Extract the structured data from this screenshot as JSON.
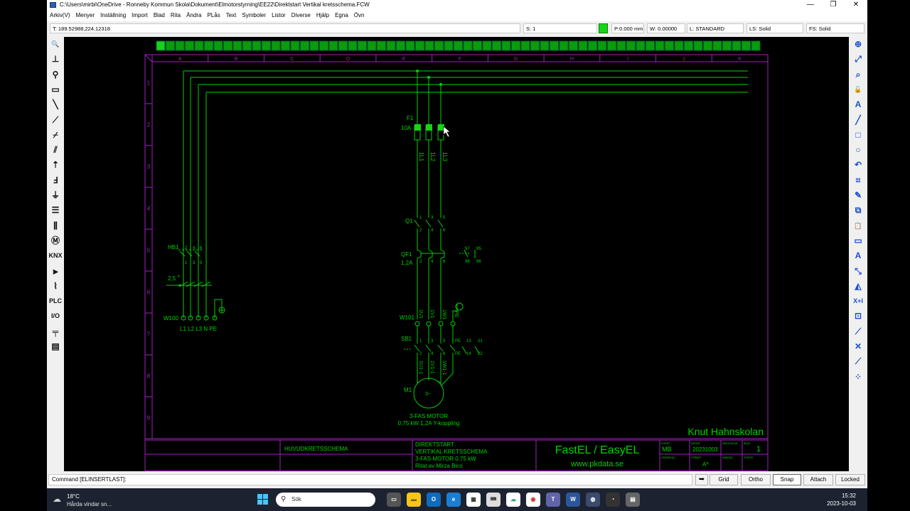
{
  "window": {
    "title": "C:\\Users\\mirbi\\OneDrive - Ronneby Kommun Skola\\Dokument\\Elmotorstyrning\\EE22\\Direktstart Vertikal kretsschema.FCW",
    "minimize": "—",
    "maximize": "❐",
    "close": "✕"
  },
  "menu": [
    "Arkiv(V)",
    "Menyer",
    "Inställning",
    "Import",
    "Blad",
    "Rita",
    "Ändra",
    "PLås",
    "Text",
    "Symboler",
    "Listor",
    "Diverse",
    "Hjälp",
    "Egna",
    "Övn"
  ],
  "status": {
    "coords": "T: 189.52988,224.12318",
    "scale": "S: 1",
    "pen": "P:0.000 mm",
    "width": "W: 0.00000",
    "layer": "L: STANDARD",
    "linestyle": "LS: Solid",
    "fillstyle": "FS: Solid",
    "pen_color": "#18d418"
  },
  "left_tools": [
    {
      "name": "zoom-icon",
      "glyph": "🔍"
    },
    {
      "name": "connection-point-icon",
      "glyph": "⊥"
    },
    {
      "name": "delete-point-icon",
      "glyph": "⚲"
    },
    {
      "name": "rectangle-select-icon",
      "glyph": "▭"
    },
    {
      "name": "line-icon",
      "glyph": "╲"
    },
    {
      "name": "bent-line-icon",
      "glyph": "⟋"
    },
    {
      "name": "switch-icon",
      "glyph": "⌿"
    },
    {
      "name": "double-switch-icon",
      "glyph": "⫽"
    },
    {
      "name": "contact-icon",
      "glyph": "⇡"
    },
    {
      "name": "relay-icon",
      "glyph": "Ⅎ"
    },
    {
      "name": "ground-icon",
      "glyph": "⏚"
    },
    {
      "name": "busbar-icon",
      "glyph": "☰"
    },
    {
      "name": "terminal-icon",
      "glyph": "⫼"
    },
    {
      "name": "motor-icon",
      "glyph": "Ⓜ"
    },
    {
      "name": "knx-icon",
      "glyph": "KNX"
    },
    {
      "name": "multi-wire-icon",
      "glyph": "⫸"
    },
    {
      "name": "fuse-icon",
      "glyph": "⌇"
    },
    {
      "name": "plc-icon",
      "glyph": "PLC"
    },
    {
      "name": "io-icon",
      "glyph": "I/O"
    },
    {
      "name": "rail-icon",
      "glyph": "╤"
    },
    {
      "name": "list-icon",
      "glyph": "▤"
    }
  ],
  "right_tools": [
    {
      "name": "zoom-in-icon",
      "glyph": "⊕"
    },
    {
      "name": "zoom-fit-icon",
      "glyph": "⤢"
    },
    {
      "name": "zoom-window-icon",
      "glyph": "⌕"
    },
    {
      "name": "lock-icon",
      "glyph": "🔓"
    },
    {
      "name": "text-icon",
      "glyph": "A"
    },
    {
      "name": "draw-line-icon",
      "glyph": "╱"
    },
    {
      "name": "draw-rectangle-icon",
      "glyph": "□"
    },
    {
      "name": "draw-circle-icon",
      "glyph": "○"
    },
    {
      "name": "undo-icon",
      "glyph": "↶"
    },
    {
      "name": "trim-icon",
      "glyph": "⌗"
    },
    {
      "name": "eraser-icon",
      "glyph": "✎"
    },
    {
      "name": "copy-icon",
      "glyph": "⧉"
    },
    {
      "name": "paste-icon",
      "glyph": "📋"
    },
    {
      "name": "move-icon",
      "glyph": "▭"
    },
    {
      "name": "edit-text-icon",
      "glyph": "A"
    },
    {
      "name": "extend-icon",
      "glyph": "⤡"
    },
    {
      "name": "mirror-icon",
      "glyph": "◭"
    },
    {
      "name": "explode-icon",
      "glyph": "X+I"
    },
    {
      "name": "snap-center-icon",
      "glyph": "⊡"
    },
    {
      "name": "snap-end-icon",
      "glyph": "⟋"
    },
    {
      "name": "snap-intersect-icon",
      "glyph": "✕"
    },
    {
      "name": "snap-near-icon",
      "glyph": "⟋"
    },
    {
      "name": "snap-midpoint-icon",
      "glyph": "⁘"
    }
  ],
  "command": {
    "text": "Command [ELINSERTLAST]:",
    "grid": "Grid",
    "ortho": "Ortho",
    "snap": "Snap",
    "attach": "Attach",
    "locked": "Locked"
  },
  "drawing": {
    "columns": [
      "A",
      "B",
      "C",
      "D",
      "E",
      "F",
      "G",
      "H",
      "I",
      "J",
      "K"
    ],
    "rows": [
      "1",
      "2",
      "3",
      "4",
      "5",
      "6",
      "7",
      "8",
      "9"
    ],
    "fuse_label": "F1",
    "fuse_rating": "10A",
    "fuse_terminals": [
      "1L1",
      "1L2",
      "1L3"
    ],
    "contactor": "Q1",
    "contactor_pins": [
      "1",
      "3",
      "5",
      "2",
      "4",
      "6"
    ],
    "breaker": "QF1",
    "breaker_rating": "1,2A",
    "breaker_pins": [
      "2",
      "4",
      "6"
    ],
    "breaker_aux": [
      "97",
      "95",
      "98",
      "96"
    ],
    "main_switch": "HB1",
    "main_switch_pins": [
      "2",
      "4",
      "6",
      "1",
      "3",
      "5"
    ],
    "cable_size": "2,5",
    "cable_sup": "#",
    "terminal_block": "W100",
    "terminal_labels": "L1 L2 L3  N PE",
    "motor_terminal": "W101",
    "motor_terminal_labels": [
      "1U1",
      "1V1",
      "1W1",
      "PE"
    ],
    "switch_sb1": "SB1",
    "sb1_pins": [
      "1",
      "3",
      "5",
      "2",
      "4",
      "6"
    ],
    "sb1_aux": [
      "PE",
      "13",
      "21",
      "PE",
      "14",
      "22"
    ],
    "motor_wires": [
      "1U1-1",
      "1V1-1",
      "1W1-1"
    ],
    "motor": "M1",
    "motor_symbol": "3~",
    "motor_desc1": "3-FAS MOTOR",
    "motor_desc2": "0,75 kW 1,2A Y-koppling",
    "school": "Knut Hahnskolan",
    "tb_main": "HUVUDKRETSSCHEMA",
    "tb_desc": [
      "DIREKTSTART",
      "VERTIKAL KRETSSCHEMA",
      "3-FAS MOTOR 0,75 kW",
      "Ritat av Mirza Bico"
    ],
    "tb_brand": "FastEL / EasyEL",
    "tb_web": "www.pkdata.se",
    "tb_author": "MB",
    "tb_date": "20231003",
    "tb_sheet": "1",
    "tb_size": "A*",
    "tb_sheet_label": "BLAD",
    "tb_date_label": "DATUM",
    "tb_author_label": "KONST",
    "tb_next_label": "NÄSTA BLAD",
    "tb_approved_label": "GRANSKAD",
    "tb_size_label": "FÖRMAT",
    "tb_rev_label": "ÄNDRAD",
    "tb_status_label": "STATUS"
  },
  "taskbar": {
    "temp": "18°C",
    "weather": "Hårda vindar sn...",
    "search": "Sök",
    "time": "15:32",
    "date": "2023-10-03"
  },
  "colors": {
    "schematic": "#00d200",
    "frame": "#a020c0",
    "background": "#000000"
  }
}
